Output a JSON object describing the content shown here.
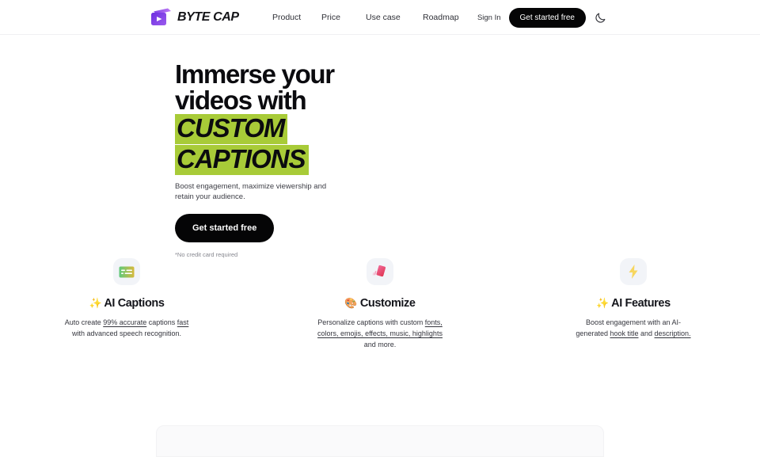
{
  "navbar": {
    "brand": {
      "name": "BYTE CAP",
      "icon": "video-play-logo-icon",
      "color": "#7B3FE4"
    },
    "links": [
      {
        "label": "Product"
      },
      {
        "label": "Price"
      },
      {
        "label": "Use case"
      },
      {
        "label": "Roadmap"
      }
    ],
    "sign_in_label": "Sign In",
    "cta_label": "Get started free",
    "theme_toggle_icon": "moon-icon"
  },
  "hero": {
    "headline_line1": "Immerse your",
    "headline_line2": "videos with",
    "highlight_line1": "CUSTOM",
    "highlight_line2": "CAPTIONS",
    "highlight_color": "#A8CB38",
    "subhead": "Boost engagement, maximize viewership and retain your audience.",
    "cta_label": "Get started free",
    "note": "*No credit card required"
  },
  "features": [
    {
      "icon": "captions-icon",
      "emoji": "✨",
      "title": "AI Captions",
      "desc_parts": [
        {
          "text": "Auto create ",
          "underline": false
        },
        {
          "text": "99% accurate",
          "underline": true
        },
        {
          "text": " captions ",
          "underline": false
        },
        {
          "text": "fast",
          "underline": true
        },
        {
          "text": " with advanced speech recognition.",
          "underline": false
        }
      ]
    },
    {
      "icon": "style-card-icon",
      "emoji": "🎨",
      "title": "Customize",
      "desc_parts": [
        {
          "text": "Personalize captions with custom ",
          "underline": false
        },
        {
          "text": "fonts, colors, emojis, effects, music, highlights",
          "underline": true
        },
        {
          "text": " and more.",
          "underline": false
        }
      ]
    },
    {
      "icon": "lightning-bolt-icon",
      "emoji": "✨",
      "title": "AI Features",
      "desc_parts": [
        {
          "text": "Boost engagement with an AI-generated ",
          "underline": false
        },
        {
          "text": "hook title",
          "underline": true
        },
        {
          "text": " and ",
          "underline": false
        },
        {
          "text": "description.",
          "underline": true
        }
      ]
    }
  ]
}
